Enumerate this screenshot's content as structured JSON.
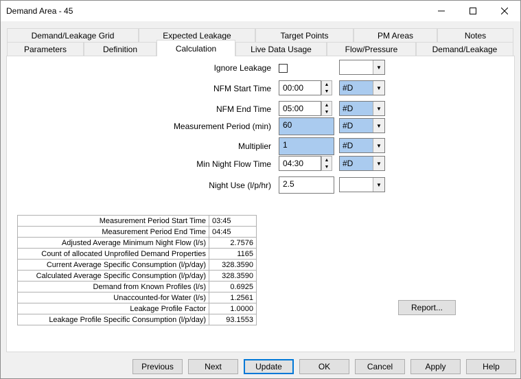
{
  "window": {
    "title": "Demand Area - 45"
  },
  "tabs_row1": [
    "Demand/Leakage Grid",
    "Expected Leakage",
    "Target Points",
    "PM Areas",
    "Notes"
  ],
  "tabs_row2": [
    "Parameters",
    "Definition",
    "Calculation",
    "Live Data Usage",
    "Flow/Pressure",
    "Demand/Leakage"
  ],
  "form": {
    "ignore_leakage_label": "Ignore Leakage",
    "nfm_start_label": "NFM Start Time",
    "nfm_start_value": "00:00",
    "nfm_start_flag": "#D",
    "nfm_end_label": "NFM End Time",
    "nfm_end_value": "05:00",
    "nfm_end_flag": "#D",
    "measurement_period_label": "Measurement Period (min)",
    "measurement_period_value": "60",
    "measurement_period_flag": "#D",
    "multiplier_label": "Multiplier",
    "multiplier_value": "1",
    "multiplier_flag": "#D",
    "min_night_flow_label": "Min Night Flow Time",
    "min_night_flow_value": "04:30",
    "min_night_flow_flag": "#D",
    "night_use_label": "Night Use (l/p/hr)",
    "night_use_value": "2.5"
  },
  "stats": [
    {
      "k": "Measurement Period Start Time",
      "v": "03:45"
    },
    {
      "k": "Measurement Period End Time",
      "v": "04:45"
    },
    {
      "k": "Adjusted Average Minimum Night Flow (l/s)",
      "v": "2.7576"
    },
    {
      "k": "Count of allocated Unprofiled Demand Properties",
      "v": "1165"
    },
    {
      "k": "Current Average Specific Consumption (l/p/day)",
      "v": "328.3590"
    },
    {
      "k": "Calculated Average Specific Consumption (l/p/day)",
      "v": "328.3590"
    },
    {
      "k": "Demand from Known Profiles (l/s)",
      "v": "0.6925"
    },
    {
      "k": "Unaccounted-for Water (l/s)",
      "v": "1.2561"
    },
    {
      "k": "Leakage Profile Factor",
      "v": "1.0000"
    },
    {
      "k": "Leakage Profile Specific Consumption (l/p/day)",
      "v": "93.1553"
    }
  ],
  "buttons": {
    "report": "Report...",
    "previous": "Previous",
    "next": "Next",
    "update": "Update",
    "ok": "OK",
    "cancel": "Cancel",
    "apply": "Apply",
    "help": "Help"
  }
}
